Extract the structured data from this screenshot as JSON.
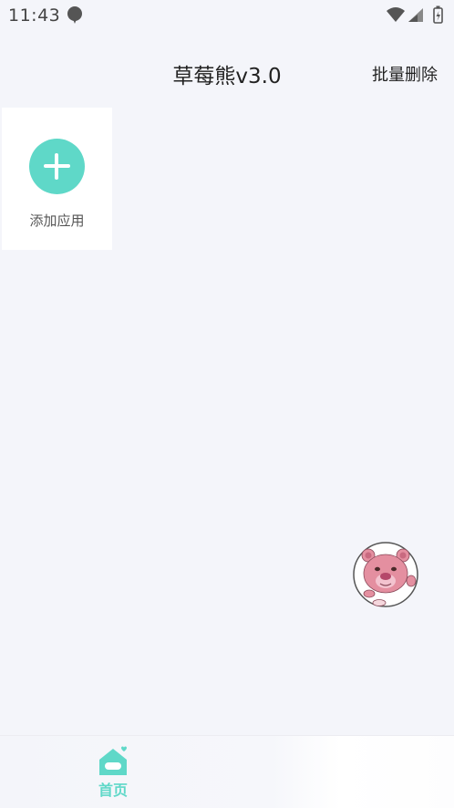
{
  "status_bar": {
    "time": "11:43",
    "icons": [
      "notification-icon",
      "wifi-icon",
      "signal-icon",
      "battery-icon"
    ]
  },
  "header": {
    "title": "草莓熊v3.0",
    "batch_delete_label": "批量删除"
  },
  "apps": {
    "add_label": "添加应用"
  },
  "floating_button": {
    "icon": "lotso-bear-icon"
  },
  "bottom_nav": {
    "home_label": "首页",
    "home_icon": "home-icon"
  },
  "colors": {
    "accent": "#5fd8c8",
    "background": "#f4f5fa",
    "bear_pink": "#e48fa0"
  }
}
